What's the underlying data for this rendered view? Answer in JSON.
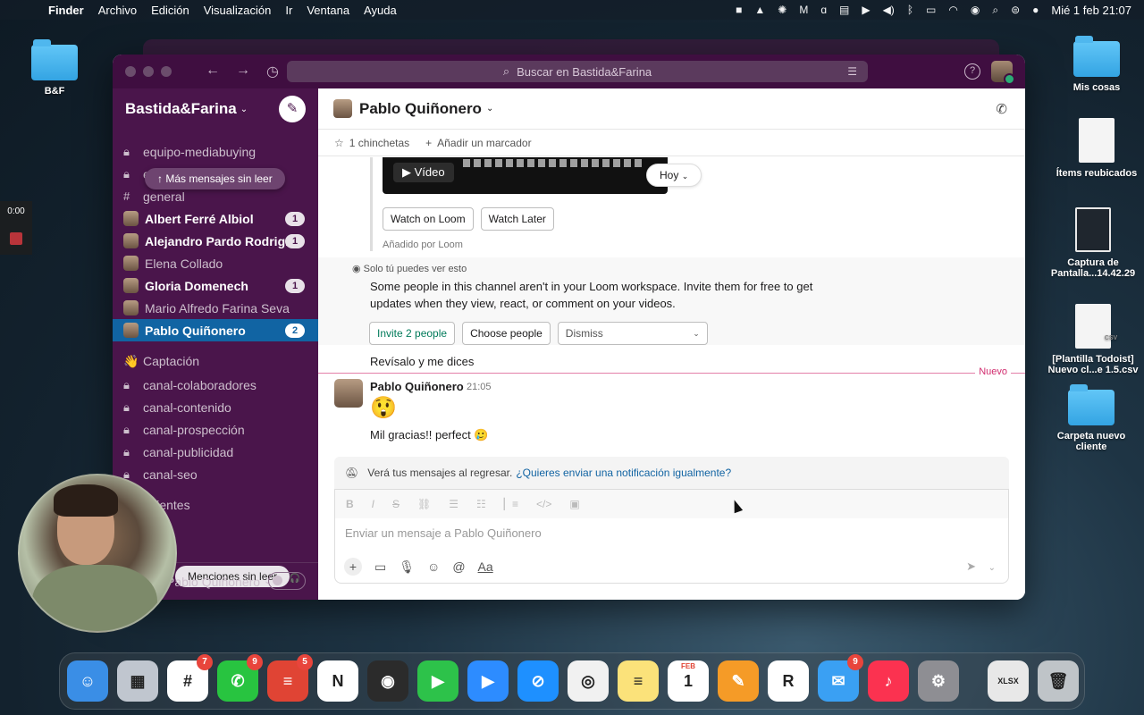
{
  "menubar": {
    "app": "Finder",
    "items": [
      "Archivo",
      "Edición",
      "Visualización",
      "Ir",
      "Ventana",
      "Ayuda"
    ],
    "clock": "Mié 1 feb 21:07"
  },
  "desktop": {
    "left_folder": "B&F",
    "right_items": [
      {
        "label": "Mis cosas",
        "kind": "folder"
      },
      {
        "label": "Ítems reubicados",
        "kind": "doc"
      },
      {
        "label": "Captura de Pantalla...14.42.29",
        "kind": "screenshot"
      },
      {
        "label": "[Plantilla Todoist] Nuevo cl...e 1.5.csv",
        "kind": "csv",
        "ext": "CSV"
      },
      {
        "label": "Carpeta nuevo cliente",
        "kind": "folder"
      }
    ],
    "recording_time": "0:00"
  },
  "slack": {
    "search_placeholder": "Buscar en Bastida&Farina",
    "workspace": "Bastida&Farina",
    "unread_pill": "Más mensajes sin leer",
    "mentions_pill": "Menciones sin leer",
    "sidebar_items": [
      {
        "kind": "channel",
        "label": "equipo-mediabuying",
        "bold": false
      },
      {
        "kind": "channel",
        "label": "equipo-ventas",
        "bold": false
      },
      {
        "kind": "hash",
        "label": "general",
        "bold": false
      },
      {
        "kind": "dm",
        "label": "Albert Ferré Albiol",
        "bold": true,
        "badge": "1"
      },
      {
        "kind": "dm",
        "label": "Alejandro Pardo Rodrig...",
        "bold": true,
        "badge": "1"
      },
      {
        "kind": "dm",
        "label": "Elena Collado",
        "bold": false
      },
      {
        "kind": "dm",
        "label": "Gloria Domenech",
        "bold": true,
        "badge": "1"
      },
      {
        "kind": "dm",
        "label": "Mario Alfredo Farina Seva",
        "bold": false
      },
      {
        "kind": "dm",
        "label": "Pablo Quiñonero",
        "bold": true,
        "badge": "2",
        "active": true
      }
    ],
    "section_captacion": "Captación",
    "section_emoji": "👋",
    "captacion_channels": [
      "canal-colaboradores",
      "canal-contenido",
      "canal-prospección",
      "canal-publicidad",
      "canal-seo"
    ],
    "section_clientes": "Clientes",
    "footer_user": "Pablo Quiñonero",
    "channel": {
      "title": "Pablo Quiñonero",
      "pins": "1 chinchetas",
      "add_bookmark": "Añadir un marcador",
      "video_label": "Vídeo",
      "day_pill": "Hoy",
      "loom_buttons": [
        "Watch on Loom",
        "Watch Later"
      ],
      "added_by": "Añadido por Loom",
      "ephemeral_note": "Solo tú puedes ver esto",
      "ephemeral_text": "Some people in this channel aren't in your Loom workspace. Invite them for free to get updates when they view, react, or comment on your videos.",
      "invite_button": "Invite 2 people",
      "choose_button": "Choose people",
      "dismiss_select": "Dismiss",
      "previous_message": "Revísalo y me dices",
      "new_divider": "Nuevo",
      "message": {
        "author": "Pablo Quiñonero",
        "time": "21:05",
        "emoji": "😲",
        "text": "Mil gracias!! perfect 🥲"
      },
      "away_banner": "Verá tus mensajes al regresar.",
      "away_link": "¿Quieres enviar una notificación igualmente?",
      "composer_placeholder": "Enviar un mensaje a Pablo Quiñonero",
      "format_text_label": "Aa"
    }
  },
  "dock": {
    "apps": [
      {
        "name": "finder",
        "color": "#3a8ee6",
        "glyph": "☺"
      },
      {
        "name": "launchpad",
        "color": "#c0c6cf",
        "glyph": "▦"
      },
      {
        "name": "slack",
        "color": "#ffffff",
        "glyph": "#",
        "badge": "7"
      },
      {
        "name": "whatsapp",
        "color": "#28c440",
        "glyph": "✆",
        "badge": "9"
      },
      {
        "name": "todoist",
        "color": "#e04434",
        "glyph": "≡",
        "badge": "5"
      },
      {
        "name": "notion",
        "color": "#ffffff",
        "glyph": "N"
      },
      {
        "name": "obs",
        "color": "#2b2b2b",
        "glyph": "◉"
      },
      {
        "name": "facetime",
        "color": "#2dc24a",
        "glyph": "▶"
      },
      {
        "name": "zoom",
        "color": "#2d8cff",
        "glyph": "▶"
      },
      {
        "name": "safari",
        "color": "#1e90ff",
        "glyph": "⊘"
      },
      {
        "name": "chrome",
        "color": "#f1f1f1",
        "glyph": "◎"
      },
      {
        "name": "notes",
        "color": "#fbe27a",
        "glyph": "≡"
      },
      {
        "name": "calendar",
        "color": "#ffffff",
        "glyph": "1",
        "top": "FEB"
      },
      {
        "name": "pages",
        "color": "#f59b27",
        "glyph": "✎"
      },
      {
        "name": "readdle",
        "color": "#ffffff",
        "glyph": "R"
      },
      {
        "name": "mail",
        "color": "#3aa0f3",
        "glyph": "✉",
        "badge": "9"
      },
      {
        "name": "music",
        "color": "#fb3250",
        "glyph": "♪"
      },
      {
        "name": "system-preferences",
        "color": "#8e8e93",
        "glyph": "⚙"
      }
    ],
    "trailing": [
      {
        "name": "xlsx-file",
        "color": "#e8e8e8",
        "glyph": "XLSX"
      },
      {
        "name": "trash",
        "color": "#bfc4c8",
        "glyph": "🗑"
      }
    ]
  }
}
